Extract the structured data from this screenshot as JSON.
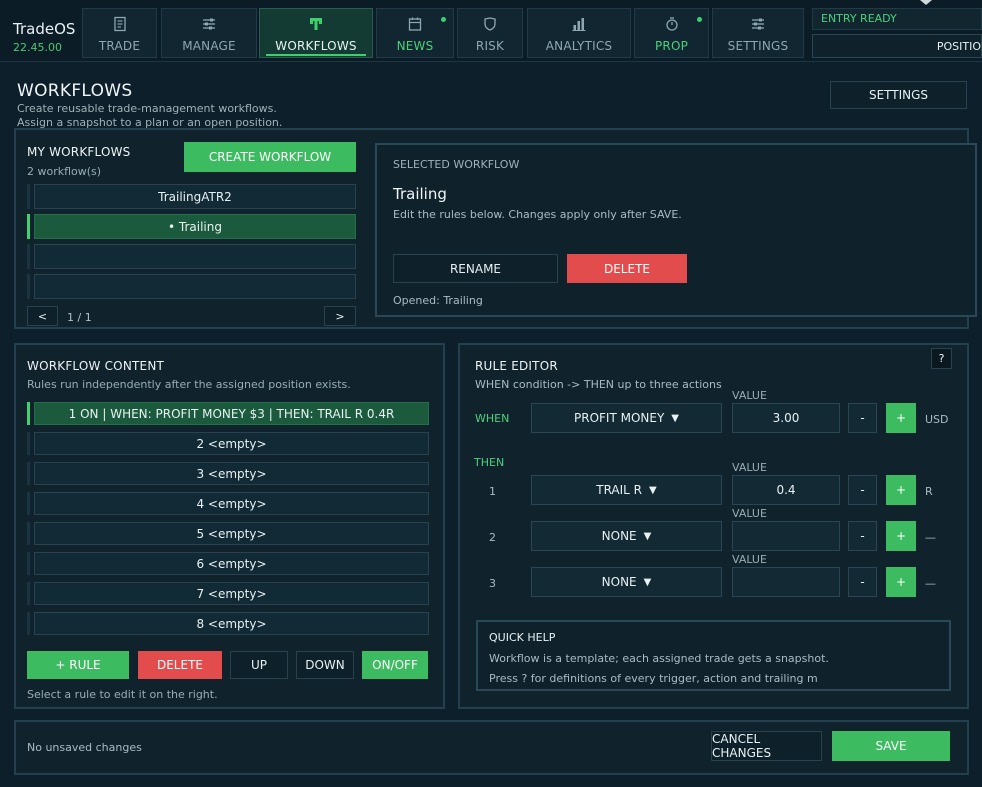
{
  "app": {
    "name": "TradeOS",
    "version": "22.45.00"
  },
  "nav": {
    "tabs": [
      {
        "label": "TRADE",
        "icon": "document-icon"
      },
      {
        "label": "MANAGE",
        "icon": "sliders-icon"
      },
      {
        "label": "WORKFLOWS",
        "icon": "workflow-icon"
      },
      {
        "label": "NEWS",
        "icon": "calendar-icon"
      },
      {
        "label": "RISK",
        "icon": "shield-icon"
      },
      {
        "label": "ANALYTICS",
        "icon": "bar-chart-icon"
      },
      {
        "label": "PROP",
        "icon": "stopwatch-icon"
      },
      {
        "label": "SETTINGS",
        "icon": "sliders-icon"
      }
    ],
    "entry_status": "ENTRY READY",
    "position_text": "POSITIO"
  },
  "header": {
    "title": "WORKFLOWS",
    "subtitle_1": "Create reusable trade-management workflows.",
    "subtitle_2": "Assign a snapshot to a plan or an open position.",
    "settings_label": "SETTINGS"
  },
  "my_workflows": {
    "title": "MY WORKFLOWS",
    "count": "2 workflow(s)",
    "create_label": "CREATE WORKFLOW",
    "items": [
      "TrailingATR2",
      "• Trailing",
      "",
      ""
    ],
    "prev_label": "<",
    "next_label": ">",
    "page": "1 / 1"
  },
  "selected": {
    "heading": "SELECTED WORKFLOW",
    "name": "Trailing",
    "hint": "Edit the rules below. Changes apply only after SAVE.",
    "rename_label": "RENAME",
    "delete_label": "DELETE",
    "opened": "Opened: Trailing"
  },
  "content": {
    "title": "WORKFLOW CONTENT",
    "subtitle": "Rules run independently after the assigned position exists.",
    "rules": [
      "1  ON | WHEN: PROFIT MONEY $3 | THEN: TRAIL R 0.4R",
      "2  <empty>",
      "3  <empty>",
      "4  <empty>",
      "5  <empty>",
      "6  <empty>",
      "7  <empty>",
      "8  <empty>"
    ],
    "add_label": "+ RULE",
    "delete_label": "DELETE",
    "up_label": "UP",
    "down_label": "DOWN",
    "toggle_label": "ON/OFF",
    "hint": "Select a rule to edit it on the right."
  },
  "editor": {
    "title": "RULE EDITOR",
    "subtitle": "WHEN condition -> THEN up to three actions",
    "help_label": "?",
    "value_label": "VALUE",
    "when_label": "WHEN",
    "then_label": "THEN",
    "when": {
      "select": "PROFIT MONEY",
      "value": "3.00",
      "unit": "USD"
    },
    "actions": [
      {
        "num": "1",
        "select": "TRAIL R",
        "value": "0.4",
        "unit": "R"
      },
      {
        "num": "2",
        "select": "NONE",
        "value": "",
        "unit": "—"
      },
      {
        "num": "3",
        "select": "NONE",
        "value": "",
        "unit": "—"
      }
    ],
    "minus_label": "-",
    "plus_label": "+",
    "arrow": "▼",
    "quick_help": {
      "title": "QUICK HELP",
      "line1": "Workflow is a template; each assigned trade gets a snapshot.",
      "line2": "Press ? for definitions of every trigger, action and trailing m"
    }
  },
  "footer": {
    "status": "No unsaved changes",
    "cancel_label": "CANCEL CHANGES",
    "save_label": "SAVE"
  },
  "colors": {
    "accent_green": "#3dbb61",
    "danger_red": "#e24c4c",
    "background": "#0d1f2a"
  }
}
